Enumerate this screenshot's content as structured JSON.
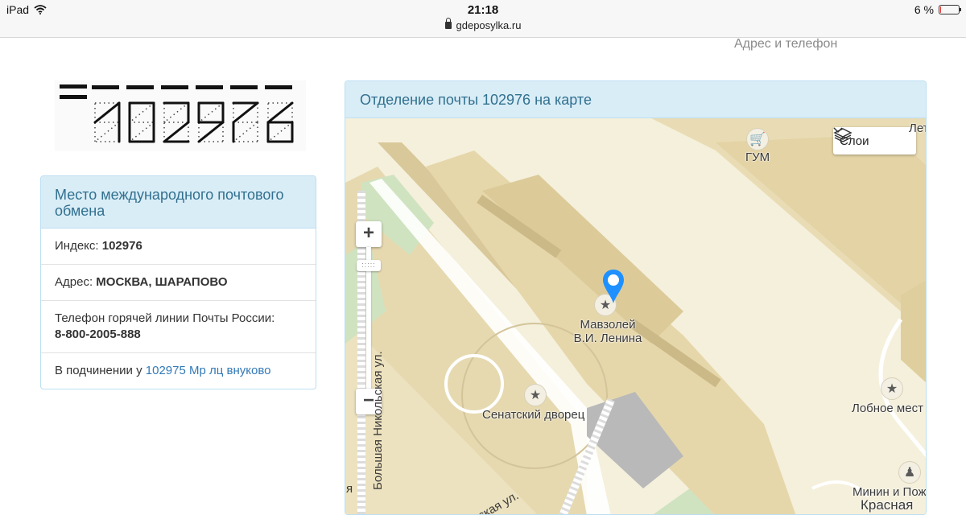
{
  "statusbar": {
    "device": "iPad",
    "time": "21:18",
    "url": "gdeposylka.ru",
    "battery": "6 %",
    "battery_level": 0.06
  },
  "header": {
    "contact_link": "Адрес и телефон"
  },
  "postcode": {
    "digits": [
      "1",
      "0",
      "2",
      "9",
      "7",
      "6"
    ]
  },
  "info": {
    "title": "Место международного почтового обмена",
    "index_label": "Индекс:",
    "index_value": "102976",
    "address_label": "Адрес:",
    "address_value": "МОСКВА, ШАРАПОВО",
    "phone_label": "Телефон горячей линии Почты России:",
    "phone_value": "8-800-2005-888",
    "parent_label": "В подчинении у",
    "parent_link": "102975 Мр лц внуково"
  },
  "map": {
    "title": "Отделение почты 102976 на карте",
    "layers_label": "Слои",
    "zoom_in": "+",
    "zoom_out": "−",
    "labels": {
      "gum": "ГУМ",
      "mausoleum_line1": "Мавзолей",
      "mausoleum_line2": "В.И. Ленина",
      "senate": "Сенатский дворец",
      "lobnoe": "Лобное мест",
      "minin": "Минин и Пож",
      "krasnaya": "Красная",
      "street_nikolskaya": "Большая Никольская ул.",
      "street_ilyinka": "ская ул.",
      "edge_ya": "я",
      "top_let": "Лет"
    },
    "colors": {
      "background": "#f4efd9",
      "buildings": "#e9ddb8",
      "green": "#cfe3c0",
      "marker": "#1e90ff"
    }
  }
}
